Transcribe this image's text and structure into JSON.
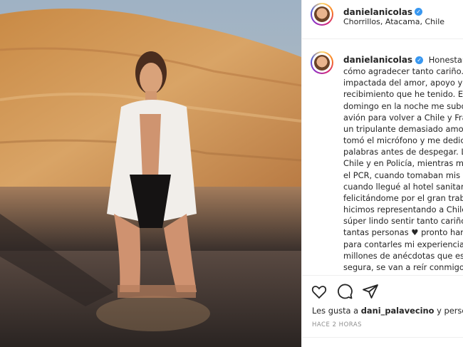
{
  "post": {
    "username": "danielanicolas",
    "location": "Chorrillos, Atacama, Chile",
    "caption_lines": [
      "Honestamen",
      "cómo agradecer tanto cariño. E",
      "impactada del amor, apoyo y",
      "recibimiento que he tenido. El",
      "domingo en la noche me subo",
      "avión para volver a Chile y Fran",
      "un tripulante demasiado amoro",
      "tomó el micrófono y me dedicó",
      "palabras antes de despegar. Lle",
      "Chile y en Policía, mientras me",
      "el PCR, cuando tomaban mis d",
      "cuando llegué al hotel sanitario",
      "felicitándome por el gran trabaj",
      "hicimos representando a Chile",
      "súper lindo sentir tanto cariño",
      "tantas personas ♥ pronto haré",
      "para contarles mi experiencia y",
      "millones de anécdotas que esto",
      "segura, se van a reír conmigo 😊"
    ],
    "likes_prefix": "Les gusta a ",
    "likes_user": "dani_palavecino",
    "likes_suffix": " y persona",
    "time_ago": "HACE 2 HORAS"
  },
  "icons": [
    "heart-icon",
    "comment-icon",
    "share-icon",
    "verified-badge-icon"
  ],
  "colors": {
    "verified": "#3897f0",
    "text": "#262626",
    "muted": "#8e8e8e"
  }
}
